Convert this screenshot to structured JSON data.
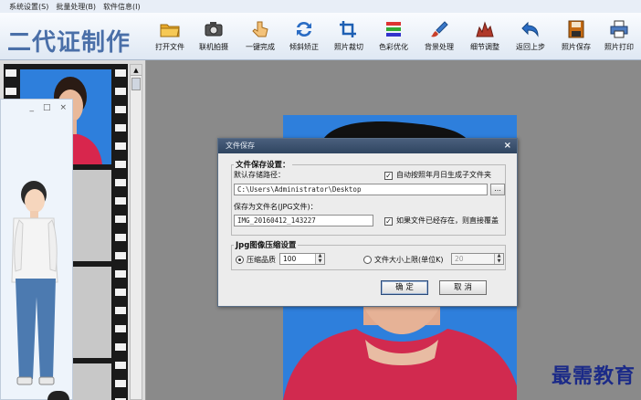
{
  "menu": [
    "系统设置(S)",
    "批量处理(B)",
    "软件信息(I)"
  ],
  "app_title": "二代证制作",
  "toolbar": [
    {
      "label": "打开文件",
      "icon": "folder-icon"
    },
    {
      "label": "联机拍摄",
      "icon": "camera-icon"
    },
    {
      "label": "一键完成",
      "icon": "hand-pointer-icon"
    },
    {
      "label": "倾斜矫正",
      "icon": "rotate-arrows-icon"
    },
    {
      "label": "照片裁切",
      "icon": "crop-icon"
    },
    {
      "label": "色彩优化",
      "icon": "color-bars-icon"
    },
    {
      "label": "背景处理",
      "icon": "brush-icon"
    },
    {
      "label": "细节调整",
      "icon": "histogram-icon"
    },
    {
      "label": "返回上步",
      "icon": "undo-icon"
    },
    {
      "label": "照片保存",
      "icon": "save-disk-icon"
    },
    {
      "label": "照片打印",
      "icon": "printer-icon"
    }
  ],
  "avatar_window": {
    "controls": [
      "_",
      "□",
      "×"
    ]
  },
  "dialog": {
    "title": "文件保存",
    "close": "×",
    "save_group_title": "文件保存设置：",
    "path_label": "默认存储路径：",
    "auto_subfolder_label": "自动按照年月日生成子文件夹",
    "auto_subfolder_checked": true,
    "path_value": "C:\\Users\\Administrator\\Desktop",
    "browse_label": "...",
    "filename_label": "保存为文件名(JPG文件)：",
    "filename_value": "IMG_20160412_143227",
    "overwrite_label": "如果文件已经存在，则直接覆盖",
    "overwrite_checked": true,
    "jpg_group_title": "Jpg图像压缩设置",
    "quality_label": "压缩品质",
    "quality_value": "100",
    "quality_selected": true,
    "filesize_label": "文件大小上限(单位K)",
    "filesize_value": "20",
    "ok_label": "确  定",
    "cancel_label": "取  消"
  },
  "watermark": "最需教育",
  "colors": {
    "photo_bg": "#2e7fdc",
    "title_blue": "#4a6fa8",
    "dialog_title": "#2f4560",
    "watermark": "#1b2a88"
  }
}
